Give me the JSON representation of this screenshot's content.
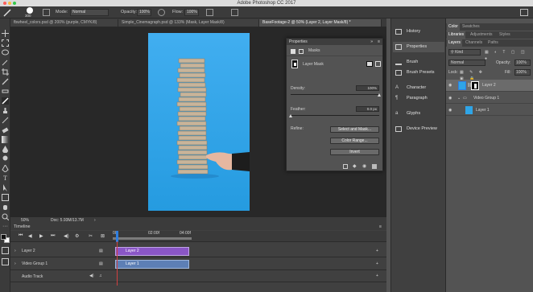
{
  "app_title": "Adobe Photoshop CC 2017",
  "options_bar": {
    "brush_size": "300",
    "mode_label": "Mode:",
    "mode_value": "Normal",
    "opacity_label": "Opacity:",
    "opacity_value": "100%",
    "flow_label": "Flow:",
    "flow_value": "100%"
  },
  "doc_tabs": [
    "fbwheel_colors.psd @ 200% (purple, CMYK/8)",
    "Simple_Cinemagraph.psd @ 133% (Mask, Layer Mask/8)",
    "BaseFootage-2 @ 50% (Layer 2, Layer Mask/8) *"
  ],
  "status": {
    "zoom": "50%",
    "doc": "Doc: 5.93M/13.7M"
  },
  "timeline": {
    "title": "Timeline",
    "ruler": [
      "00",
      "02:00f",
      "04:00f"
    ],
    "tracks": [
      {
        "label": "Layer 2",
        "clip": "Layer 2"
      },
      {
        "label": "Video Group 1",
        "clip": "Layer 1"
      },
      {
        "label": "Audio Track"
      }
    ]
  },
  "properties": {
    "title": "Properties",
    "section": "Masks",
    "mask_type": "Layer Mask",
    "density_label": "Density:",
    "density_value": "100%",
    "density_fraction": 1.0,
    "feather_label": "Feather:",
    "feather_value": "0.0 px",
    "feather_fraction": 0.0,
    "refine_label": "Refine:",
    "buttons": [
      "Select and Mask...",
      "Color Range...",
      "Invert"
    ]
  },
  "panel_strip": [
    {
      "label": "History",
      "icon": "history-icon"
    },
    {
      "label": "Properties",
      "icon": "properties-icon"
    },
    {
      "label": "Brush",
      "icon": "brush-icon"
    },
    {
      "label": "Brush Presets",
      "icon": "brush-presets-icon"
    },
    {
      "label": "Character",
      "icon": "character-icon"
    },
    {
      "label": "Paragraph",
      "icon": "paragraph-icon"
    },
    {
      "label": "Glyphs",
      "icon": "glyphs-icon"
    },
    {
      "label": "Device Preview",
      "icon": "device-preview-icon"
    }
  ],
  "right_panels": {
    "top_tabs": [
      "Color",
      "Swatches"
    ],
    "mid_tabs": [
      "Libraries",
      "Adjustments",
      "Styles"
    ],
    "layers_tabs": [
      "Layers",
      "Channels",
      "Paths"
    ],
    "filter_kind": "Kind",
    "blend_mode": "Normal",
    "opacity_label": "Opacity:",
    "opacity_value": "100%",
    "lock_label": "Lock:",
    "fill_label": "Fill:",
    "fill_value": "100%",
    "layers": [
      "Layer 2",
      "Video Group 1",
      "Layer 1"
    ]
  },
  "colors": {
    "accent": "#2f7ee0",
    "clip_purple": "#8a56c6",
    "clip_blue": "#5d7fb5",
    "canvas_blue": "#2fa5e7"
  }
}
